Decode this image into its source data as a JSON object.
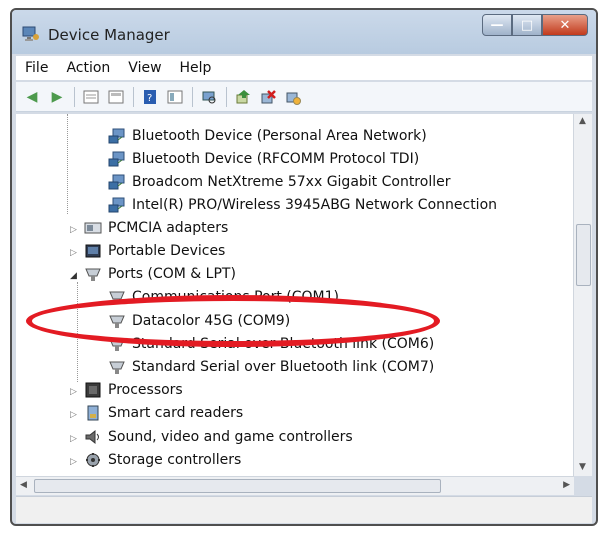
{
  "window": {
    "title": "Device Manager",
    "accent_color": "#b8cbe0"
  },
  "window_buttons": {
    "minimize": "—",
    "maximize": "□",
    "close": "✕"
  },
  "menu": [
    "File",
    "Action",
    "View",
    "Help"
  ],
  "toolbar_icons": [
    "back-icon",
    "forward-icon",
    "properties-icon",
    "show-hide-icon",
    "help-icon",
    "view-icon",
    "scan-icon",
    "update-driver-icon",
    "uninstall-icon",
    "disable-icon"
  ],
  "tree": {
    "network_children": [
      "Bluetooth Device (Personal Area Network)",
      "Bluetooth Device (RFCOMM Protocol TDI)",
      "Broadcom NetXtreme 57xx Gigabit Controller",
      "Intel(R) PRO/Wireless 3945ABG Network Connection"
    ],
    "pcmcia": "PCMCIA adapters",
    "portable": "Portable Devices",
    "ports": "Ports (COM & LPT)",
    "ports_children": [
      "Communications Port (COM1)",
      "Datacolor 45G (COM9)",
      "Standard Serial over Bluetooth link (COM6)",
      "Standard Serial over Bluetooth link (COM7)"
    ],
    "processors": "Processors",
    "smartcard": "Smart card readers",
    "sound": "Sound, video and game controllers",
    "storage": "Storage controllers"
  },
  "highlight": {
    "target": "Datacolor 45G (COM9)",
    "color": "#e31b23"
  }
}
